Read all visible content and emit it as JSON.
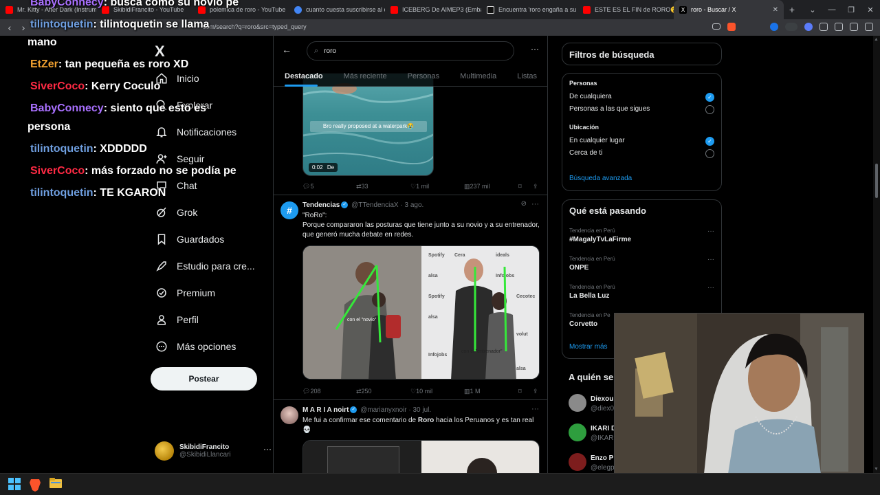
{
  "browser": {
    "tabs": [
      {
        "label": "Mr. Kitty - After Dark (Instrum",
        "color": "#ff0000"
      },
      {
        "label": "SkibidiFrancito - YouTube",
        "color": "#ff0000"
      },
      {
        "label": "polemica de roro - YouTube",
        "color": "#ff0000"
      },
      {
        "label": "cuanto cuesta suscribirse al c",
        "color": "#4285f4"
      },
      {
        "label": "ICEBERG De AIMEP3 (Embaraz",
        "color": "#ff0000"
      },
      {
        "label": "Encuentra 'roro engaña a su p",
        "color": "#ffffff"
      },
      {
        "label": "ESTE ES EL FIN de RORO😮 H",
        "color": "#ff0000"
      },
      {
        "label": "roro - Buscar / X",
        "color": "#ffffff"
      }
    ],
    "url": "com/search?q=roro&src=typed_query",
    "new_tab": "+",
    "tab_close": "✕"
  },
  "chat": [
    {
      "user": "BabyConnecy",
      "color": "#a970ff",
      "message": ": busca como su novio pe"
    },
    {
      "user": "tilintoquetin",
      "color": "#6f9fe0",
      "message": ": tilintoquetin se llama"
    },
    {
      "user": "",
      "color": "#ffffff",
      "message": "mano"
    },
    {
      "user": "EtZer",
      "color": "#f0a030",
      "message": ": tan pequeña es roro XD"
    },
    {
      "user": "SiverCoco",
      "color": "#ff2a44",
      "message": ": Kerry Coculo"
    },
    {
      "user": "BabyConnecy",
      "color": "#a970ff",
      "message": ": siento que esto es"
    },
    {
      "user": "",
      "color": "#ffffff",
      "message": "persona"
    },
    {
      "user": "tilintoquetin",
      "color": "#6f9fe0",
      "message": ": XDDDDD"
    },
    {
      "user": "SiverCoco",
      "color": "#ff2a44",
      "message": ": más forzado no se podía pe"
    },
    {
      "user": "tilintoquetin",
      "color": "#6f9fe0",
      "message": ": TE KGARON"
    }
  ],
  "sidebar": {
    "logo": "X",
    "items": [
      {
        "label": "Inicio",
        "icon": "home-icon"
      },
      {
        "label": "Explorar",
        "icon": "search-icon"
      },
      {
        "label": "Notificaciones",
        "icon": "bell-icon"
      },
      {
        "label": "Seguir",
        "icon": "follow-icon"
      },
      {
        "label": "Chat",
        "icon": "chat-icon"
      },
      {
        "label": "Grok",
        "icon": "grok-icon"
      },
      {
        "label": "Guardados",
        "icon": "bookmark-icon"
      },
      {
        "label": "Estudio para cre...",
        "icon": "rocket-icon"
      },
      {
        "label": "Premium",
        "icon": "premium-icon"
      },
      {
        "label": "Perfil",
        "icon": "person-icon"
      },
      {
        "label": "Más opciones",
        "icon": "more-icon"
      }
    ],
    "post_button": "Postear",
    "profile": {
      "name": "SkibidiFrancito",
      "handle": "@SkibidiLlancari",
      "more": "···"
    }
  },
  "search": {
    "query": "roro",
    "tabs": [
      "Destacado",
      "Más reciente",
      "Personas",
      "Multimedia",
      "Listas"
    ],
    "active_tab": "Destacado",
    "more": "···"
  },
  "posts": [
    {
      "video_caption": "Bro really proposed at a waterpark😭",
      "video_time": "0:02",
      "video_from": "De",
      "replies": "5",
      "reposts": "33",
      "likes": "1 mil",
      "views": "237 mil"
    },
    {
      "name": "Tendencias",
      "handle": "@TTendenciaX",
      "time": "· 3 ago.",
      "text": "\"RoRo\":\nPorque compararon las posturas que tiene junto a su novio y a su entrenador, que generó mucha debate en redes.",
      "img_label_left": "con el \"novio\"",
      "img_label_right": "con el \"entrenador\"",
      "replies": "208",
      "reposts": "250",
      "likes": "10 mil",
      "views": "1 M"
    },
    {
      "name": "M A R I A noirt",
      "handle": "@marianyxnoir",
      "time": "· 30 jul.",
      "text_pre": "Me fui a confirmar ese comentario de ",
      "text_bold": "Roro",
      "text_post": " hacia los Peruanos y es tan real",
      "text_emoji": "💀"
    }
  ],
  "filters": {
    "title": "Filtros de búsqueda",
    "people_label": "Personas",
    "people_options": [
      {
        "label": "De cualquiera",
        "selected": true
      },
      {
        "label": "Personas a las que sigues",
        "selected": false
      }
    ],
    "location_label": "Ubicación",
    "location_options": [
      {
        "label": "En cualquier lugar",
        "selected": true
      },
      {
        "label": "Cerca de ti",
        "selected": false
      }
    ],
    "advanced": "Búsqueda avanzada"
  },
  "trends": {
    "title": "Qué está pasando",
    "items": [
      {
        "category": "Tendencia en Perú",
        "name": "#MagalyTvLaFirme"
      },
      {
        "category": "Tendencia en Perú",
        "name": "ONPE"
      },
      {
        "category": "Tendencia en Perú",
        "name": "La Bella Luz"
      },
      {
        "category": "Tendencia en Pe",
        "name": "Corvetto"
      }
    ],
    "show_more": "Mostrar más"
  },
  "who_to_follow": {
    "title": "A quién se",
    "accounts": [
      {
        "name": "Diexou",
        "handle": "@diex0"
      },
      {
        "name": "IKARI D",
        "handle": "@IKAR"
      },
      {
        "name": "Enzo P",
        "handle": "@elegp"
      }
    ]
  },
  "colors": {
    "accent": "#1d9bf0",
    "background": "#000000",
    "border": "#2f3336",
    "muted": "#71767b"
  }
}
